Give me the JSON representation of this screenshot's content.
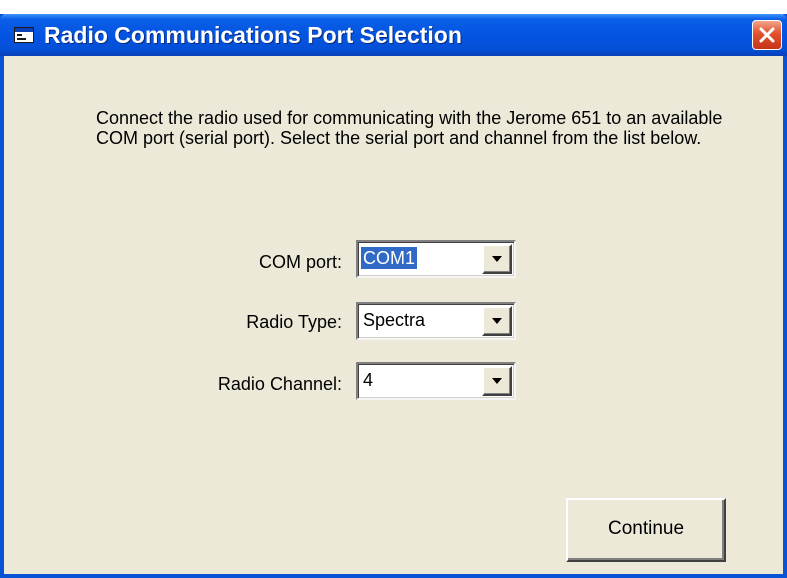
{
  "window": {
    "title": "Radio Communications Port Selection",
    "icon": "application-window-icon",
    "close_icon": "close-icon"
  },
  "description": "Connect the radio used for communicating with the Jerome 651 to an available COM port (serial port).  Select the serial port and channel from the list below.",
  "fields": {
    "com_port": {
      "label": "COM port:",
      "value": "COM1"
    },
    "radio_type": {
      "label": "Radio Type:",
      "value": "Spectra"
    },
    "radio_channel": {
      "label": "Radio Channel:",
      "value": "4"
    }
  },
  "buttons": {
    "continue_label": "Continue"
  },
  "colors": {
    "titlebar": "#0454e2",
    "window_bg": "#ece9d8",
    "close_button": "#e2512d",
    "selection": "#316ac5"
  }
}
